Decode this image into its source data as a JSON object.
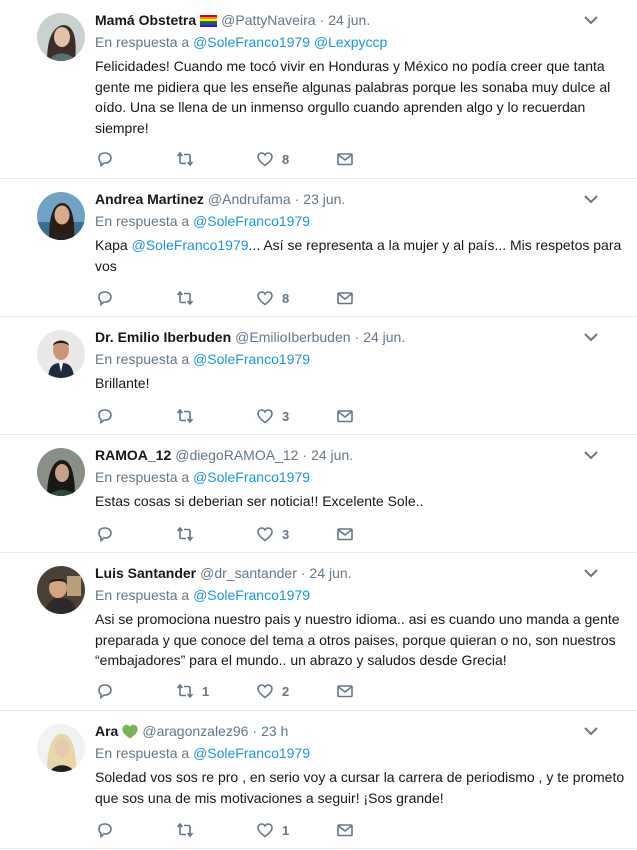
{
  "colors": {
    "link": "#1b95e0",
    "muted": "#657786",
    "text": "#14171a",
    "border": "#e6ecf0"
  },
  "reply_prefix": "En respuesta a",
  "icons": [
    "reply-icon",
    "retweet-icon",
    "like-icon",
    "direct-message-icon",
    "chevron-down-icon"
  ],
  "tweets": [
    {
      "name": "Mamá Obstetra",
      "badge": "rainbow-flag",
      "handle": "@PattyNaveira",
      "sep": "·",
      "time": "24 jun.",
      "mention1": "@SoleFranco1979",
      "mention2": "@Lexpyccp",
      "text": "Felicidades! Cuando me tocó vivir en Honduras y México no podía creer que tanta gente me pidiera que les enseñe algunas palabras porque les sonaba muy dulce al oído. Una se llena de un inmenso orgullo cuando aprenden algo y lo recuerdan siempre!",
      "replies": "",
      "retweets": "",
      "likes": "8"
    },
    {
      "name": "Andrea Martinez",
      "handle": "@Andrufama",
      "sep": "·",
      "time": "23 jun.",
      "mention1": "@SoleFranco1979",
      "text_prefix": "Kapa ",
      "text_mention": "@SoleFranco1979",
      "text_rest": "... Así se representa a la mujer y al país... Mis respetos para vos",
      "replies": "",
      "retweets": "",
      "likes": "8"
    },
    {
      "name": "Dr. Emilio Iberbuden",
      "handle": "@EmilioIberbuden",
      "sep": "·",
      "time": "24 jun.",
      "mention1": "@SoleFranco1979",
      "text": "Brillante!",
      "replies": "",
      "retweets": "",
      "likes": "3"
    },
    {
      "name": "RAMOA_12",
      "handle": "@diegoRAMOA_12",
      "sep": "·",
      "time": "24 jun.",
      "mention1": "@SoleFranco1979",
      "text": "Estas cosas si deberian ser noticia!! Excelente Sole..",
      "replies": "",
      "retweets": "",
      "likes": "3"
    },
    {
      "name": "Luis Santander",
      "handle": "@dr_santander",
      "sep": "·",
      "time": "24 jun.",
      "mention1": "@SoleFranco1979",
      "text": "Asi se promociona nuestro pais y nuestro idioma.. asi es cuando uno manda a gente preparada y que conoce del tema a otros paises, porque quieran o no, son nuestros “embajadores” para el mundo.. un abrazo y saludos desde Grecia!",
      "replies": "",
      "retweets": "1",
      "likes": "2"
    },
    {
      "name": "Ara",
      "badge": "green-heart",
      "handle": "@aragonzalez96",
      "sep": "·",
      "time": "23 h",
      "mention1": "@SoleFranco1979",
      "text": "Soledad vos sos re pro , en serio voy a cursar la carrera de periodismo , y te prometo que sos una de mis motivaciones a seguir! ¡Sos grande!",
      "replies": "",
      "retweets": "",
      "likes": "1"
    }
  ]
}
